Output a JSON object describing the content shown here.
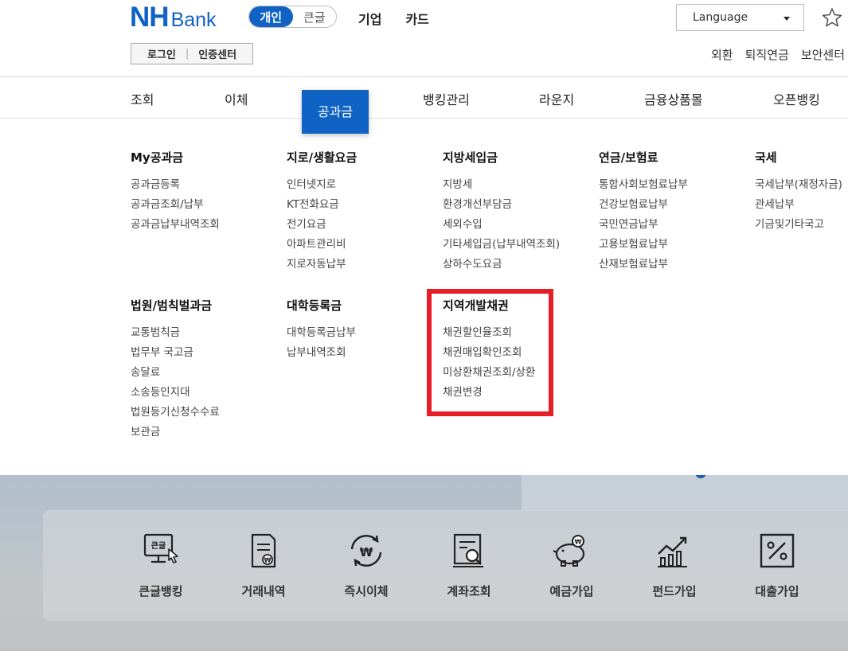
{
  "header": {
    "logo_nh": "NH",
    "logo_bank": "Bank",
    "mode_personal": "개인",
    "mode_bigtext": "큰글",
    "top_links": [
      "기업",
      "카드"
    ],
    "language_label": "Language",
    "login_label": "로그인",
    "cert_label": "인증센터",
    "util_links": [
      "외환",
      "퇴직연금",
      "보안센터"
    ]
  },
  "gnb": {
    "items": [
      "조회",
      "이체",
      "공과금",
      "뱅킹관리",
      "라운지",
      "금융상품몰",
      "오픈뱅킹"
    ],
    "active": "공과금"
  },
  "mega_menu": {
    "groups": [
      {
        "title": "My공과금",
        "links": [
          "공과금등록",
          "공과금조회/납부",
          "공과금납부내역조회"
        ]
      },
      {
        "title": "지로/생활요금",
        "links": [
          "인터넷지로",
          "KT전화요금",
          "전기요금",
          "아파트관리비",
          "지로자동납부"
        ]
      },
      {
        "title": "지방세입금",
        "links": [
          "지방세",
          "환경개선부담금",
          "세외수입",
          "기타세입금(납부내역조회)",
          "상하수도요금"
        ]
      },
      {
        "title": "연금/보험료",
        "links": [
          "통합사회보험료납부",
          "건강보험료납부",
          "국민연금납부",
          "고용보험료납부",
          "산재보험료납부"
        ]
      },
      {
        "title": "국세",
        "links": [
          "국세납부(재정자금)",
          "관세납부",
          "기금및기타국고"
        ]
      },
      {
        "title": "법원/범칙벌과금",
        "links": [
          "교통범칙금",
          "법무부 국고금",
          "송달료",
          "소송등인지대",
          "법원등기신청수수료",
          "보관금"
        ]
      },
      {
        "title": "대학등록금",
        "links": [
          "대학등록금납부",
          "납부내역조회"
        ]
      },
      {
        "title": "지역개발채권",
        "links": [
          "채권할인율조회",
          "채권매입확인조회",
          "미상환채권조회/상환",
          "채권변경"
        ]
      }
    ],
    "highlighted_group": "지역개발채권",
    "highlight_color": "#e81e26"
  },
  "quick_menu": {
    "items": [
      {
        "label": "큰글뱅킹",
        "icon": "bigtext-monitor-icon",
        "icon_text": "큰글"
      },
      {
        "label": "거래내역",
        "icon": "document-won-icon"
      },
      {
        "label": "즉시이체",
        "icon": "won-transfer-icon"
      },
      {
        "label": "계좌조회",
        "icon": "document-search-icon"
      },
      {
        "label": "예금가입",
        "icon": "piggy-bank-icon"
      },
      {
        "label": "펀드가입",
        "icon": "growth-chart-icon"
      },
      {
        "label": "대출가입",
        "icon": "percent-icon"
      }
    ]
  },
  "colors": {
    "brand_blue": "#1062c4",
    "highlight_red": "#e81e26"
  }
}
